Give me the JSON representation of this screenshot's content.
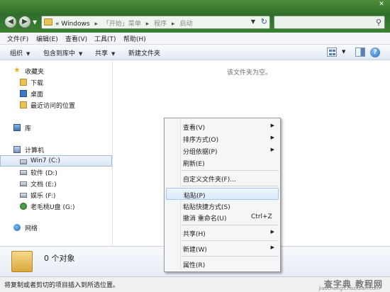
{
  "address_bar": {
    "overflow": "«",
    "crumbs": [
      "Windows",
      "「开始」菜单",
      "程序",
      "启动"
    ],
    "separator": "▸"
  },
  "menubar": [
    "文件(F)",
    "编辑(E)",
    "查看(V)",
    "工具(T)",
    "帮助(H)"
  ],
  "toolbar": {
    "organize": "组织",
    "include_in_library": "包含到库中",
    "share": "共享",
    "new_folder": "新建文件夹"
  },
  "nav": {
    "favorites": "收藏夹",
    "downloads": "下载",
    "desktop": "桌面",
    "recent": "最近访问的位置",
    "libraries": "库",
    "computer": "计算机",
    "drives": [
      {
        "label": "Win7 (C:)",
        "selected": true
      },
      {
        "label": "软件 (D:)"
      },
      {
        "label": "文档 (E:)"
      },
      {
        "label": "娱乐 (F:)"
      },
      {
        "label": "老毛桃U盘 (G:)"
      }
    ],
    "network": "网络"
  },
  "content": {
    "empty_message": "该文件夹为空。"
  },
  "details": {
    "count": "0 个对象"
  },
  "status": {
    "text": "将复制或者剪切的项目插入到所选位置。",
    "watermark": "查字典 教程网",
    "watermark_url": "jiaocheng.chazidian.com"
  },
  "context_menu": {
    "items": [
      {
        "label": "查看(V)",
        "submenu": true
      },
      {
        "label": "排序方式(O)",
        "submenu": true
      },
      {
        "label": "分组依据(P)",
        "submenu": true
      },
      {
        "label": "刷新(E)"
      },
      {
        "label": "自定义文件夹(F)..."
      },
      {
        "label": "粘贴(P)",
        "highlighted": true
      },
      {
        "label": "粘贴快捷方式(S)"
      },
      {
        "label": "撤消 重命名(U)",
        "shortcut": "Ctrl+Z"
      },
      {
        "label": "共享(H)",
        "submenu": true
      },
      {
        "label": "新建(W)",
        "submenu": true
      },
      {
        "label": "属性(R)"
      }
    ]
  },
  "colors": {
    "titlebar": "#2f6e2a",
    "highlight": "#dbe9f8"
  }
}
